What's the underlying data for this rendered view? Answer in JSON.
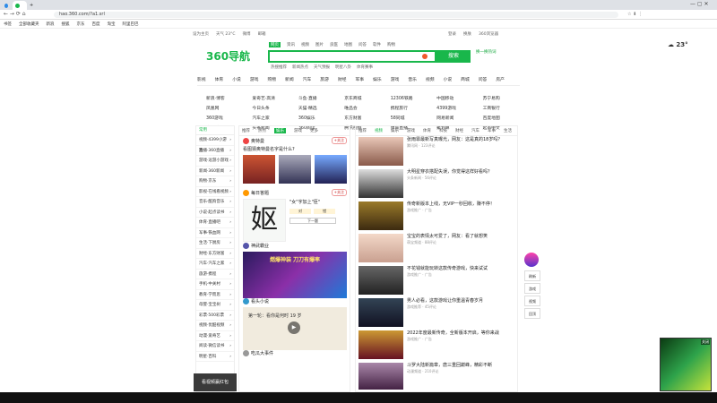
{
  "browser": {
    "tabs": [
      {
        "label": "360导航_一个..."
      },
      {
        "label": "+"
      }
    ],
    "url": "hao.360.com/?a1.srl",
    "bookmarks": [
      "书签",
      "全部收藏夹",
      "新浪",
      "搜狐",
      "京东",
      "百度",
      "淘宝",
      "阿里巴巴"
    ]
  },
  "header": {
    "logo_text": "360导航",
    "top_links": [
      "设为主页",
      "天气 23°C",
      "微博",
      "邮箱",
      "登录",
      "换肤",
      "360浏览器"
    ],
    "search_tabs": [
      "网页",
      "资讯",
      "视频",
      "图片",
      "良医",
      "地图",
      "问答",
      "软件",
      "购物"
    ],
    "search_button": "搜索",
    "hot_words": [
      "热搜推荐",
      "新闻热点",
      "天气预报",
      "明星八卦",
      "体育赛事"
    ],
    "right_link": "换一换热词"
  },
  "category_nav": [
    "影视",
    "体育",
    "小说",
    "游戏",
    "购物",
    "新闻",
    "汽车",
    "旅游",
    "财经",
    "军事",
    "娱乐",
    "游戏",
    "音乐",
    "视频",
    "小说",
    "商城",
    "问答",
    "房产"
  ],
  "grid_links": [
    [
      "新浪·博客",
      "爱奇艺·高清",
      "斗鱼·直播",
      "京东商城",
      "12306铁路",
      "中国移动",
      "苏宁易购"
    ],
    [
      "凤凰网",
      "今日头条",
      "天猫·精选",
      "唯品会",
      "携程旅行",
      "4399游戏",
      "工商银行"
    ],
    [
      "360游戏",
      "汽车之家",
      "360娱乐",
      "东方财富",
      "58同城",
      "网易新闻",
      "百度地图"
    ],
    [
      "学·教育",
      "头条新闻",
      "360阅读",
      "腾讯视频",
      "体育直播",
      "聚划算",
      "起点中文"
    ]
  ],
  "sidebar": {
    "header": "常用",
    "items": [
      "视频·4399小游戏",
      "直播·360直播",
      "游戏·逗游小游戏",
      "新闻·360新闻",
      "购物·京东",
      "影视·在线看视频",
      "音乐·酷狗音乐",
      "小说·起点读书",
      "体育·直播吧",
      "军事·铁血网",
      "生活·下厨房",
      "财经·东方财富",
      "汽车·汽车之家",
      "旅游·携程",
      "手机·中关村",
      "教育·学而思",
      "母婴·宝宝树",
      "彩票·500彩票",
      "视频·优酷视频",
      "动漫·爱奇艺",
      "阅读·微信读书",
      "明星·百科"
    ]
  },
  "middle": {
    "tabs": [
      "推荐",
      "热点",
      "娱乐",
      "游戏",
      "更多"
    ],
    "cards": [
      {
        "author": "奥特曼",
        "title": "看图猜奥特曼名字是什么?",
        "tag": "+关注"
      },
      {
        "author": "每日答题",
        "title": "\"女\"字加上\"臣\"",
        "tag": "+关注",
        "options": [
          "对",
          "错",
          "下一题"
        ]
      },
      {
        "author": "神武霸业",
        "title": "燃爆神装 刀刀有爆率",
        "tag": "+关注"
      },
      {
        "author": "看头小说",
        "title": "第一轮：看你是何时 19 岁",
        "tag": "+关注"
      },
      {
        "author": "吃瓜大事件",
        "title": "",
        "tag": ""
      }
    ],
    "video_caption": "看视频赢红包"
  },
  "right": {
    "tabs": [
      "推荐",
      "视频",
      "娱乐",
      "游戏",
      "体育",
      "科技",
      "财经",
      "汽车",
      "军事",
      "生活"
    ],
    "feed": [
      {
        "title": "张雨霏最新写真曝光，网友：这是真的18岁吗？",
        "meta": "腾讯网 · 123评论"
      },
      {
        "title": "大明星穿衣搭配失误，你觉得这样好看吗？",
        "meta": "头条新闻 · 56评论"
      },
      {
        "title": "传奇新版本上线，无VIP一秒回收，赚不停！",
        "meta": "游戏推广 · 广告"
      },
      {
        "title": "宝宝的表情太可爱了，网友：看了就想笑",
        "meta": "萌宝频道 · 88评论"
      },
      {
        "title": "不花钱就能玩转这款传奇游戏，快来试试",
        "meta": "游戏推广 · 广告"
      },
      {
        "title": "男人必看，这款游戏让你重温青春岁月",
        "meta": "游戏推荐 · 45评论"
      },
      {
        "title": "2022年度最新传奇，全新版本开启，等你来战",
        "meta": "游戏推广 · 广告"
      },
      {
        "title": "斗罗大陆新篇章，唐三重回巅峰，精彩不断",
        "meta": "动漫频道 · 210评论"
      }
    ]
  },
  "right_rail": [
    "刷新",
    "游戏",
    "视频",
    "回顶"
  ],
  "ad_label": "关闭",
  "colors": {
    "brand_green": "#19b74b",
    "link_red": "#d9402f"
  }
}
